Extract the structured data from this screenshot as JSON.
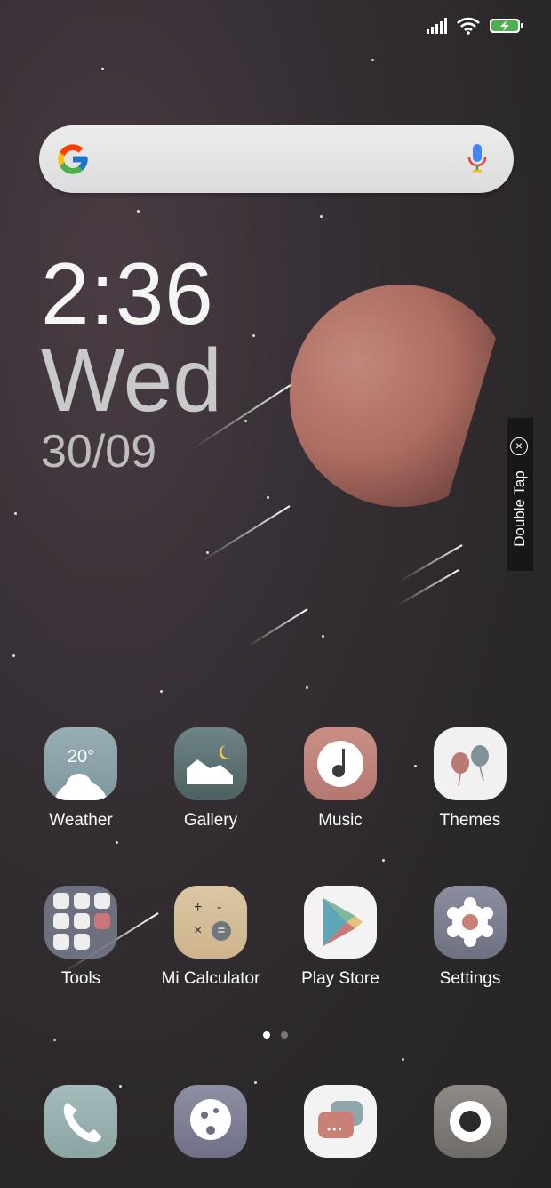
{
  "status_bar": {
    "icons": [
      "signal-icon",
      "wifi-icon",
      "battery-charging-icon"
    ],
    "battery_color": "#4caf50"
  },
  "search": {
    "logo": "google-g-icon",
    "mic": "microphone-icon"
  },
  "clock": {
    "time": "2:36",
    "day": "Wed",
    "date": "30/09"
  },
  "double_tap": {
    "label": "Double Tap",
    "close": "×"
  },
  "apps_row1": [
    {
      "label": "Weather",
      "temp": "20°",
      "icon": "weather-icon"
    },
    {
      "label": "Gallery",
      "icon": "gallery-icon"
    },
    {
      "label": "Music",
      "icon": "music-icon"
    },
    {
      "label": "Themes",
      "icon": "themes-icon"
    }
  ],
  "apps_row2": [
    {
      "label": "Tools",
      "icon": "tools-folder-icon"
    },
    {
      "label": "Mi Calculator",
      "icon": "calculator-icon"
    },
    {
      "label": "Play Store",
      "icon": "play-store-icon"
    },
    {
      "label": "Settings",
      "icon": "settings-icon"
    }
  ],
  "calculator_symbols": {
    "plus": "+",
    "minus": "-",
    "times": "×",
    "equals": "="
  },
  "pager": {
    "pages": 2,
    "current": 1
  },
  "dock": [
    {
      "icon": "phone-icon"
    },
    {
      "icon": "browser-icon"
    },
    {
      "icon": "messaging-icon"
    },
    {
      "icon": "camera-icon"
    }
  ]
}
